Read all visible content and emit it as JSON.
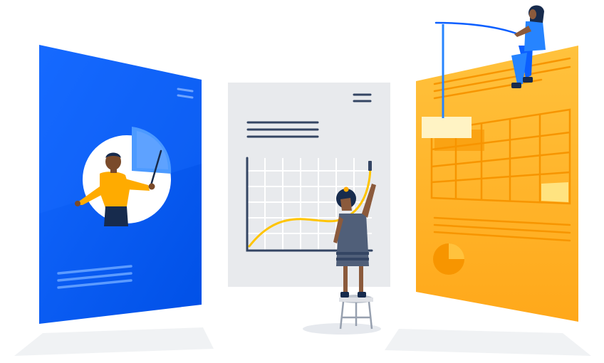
{
  "illustration": {
    "panels": [
      {
        "name": "blue-presentation-panel",
        "color": "#0B5FFF"
      },
      {
        "name": "gray-chart-panel",
        "color": "#E8EAED"
      },
      {
        "name": "orange-spreadsheet-panel",
        "color": "#FFB11F"
      }
    ],
    "people": [
      {
        "name": "presenter-person",
        "shirt": "#FFAB00"
      },
      {
        "name": "drawing-person",
        "dress": "#505F79"
      },
      {
        "name": "fishing-person",
        "outfit": "#2684FF"
      }
    ],
    "colors": {
      "background": "#FFFFFF",
      "blue": "#0B5FFF",
      "light_blue": "#4C9AFF",
      "gray_panel": "#E8EAED",
      "ink": "#344563",
      "yellow_line": "#FFC400",
      "orange_panel": "#FFB11F",
      "orange_lines": "#F79500",
      "cream": "#FFF3C4"
    }
  }
}
